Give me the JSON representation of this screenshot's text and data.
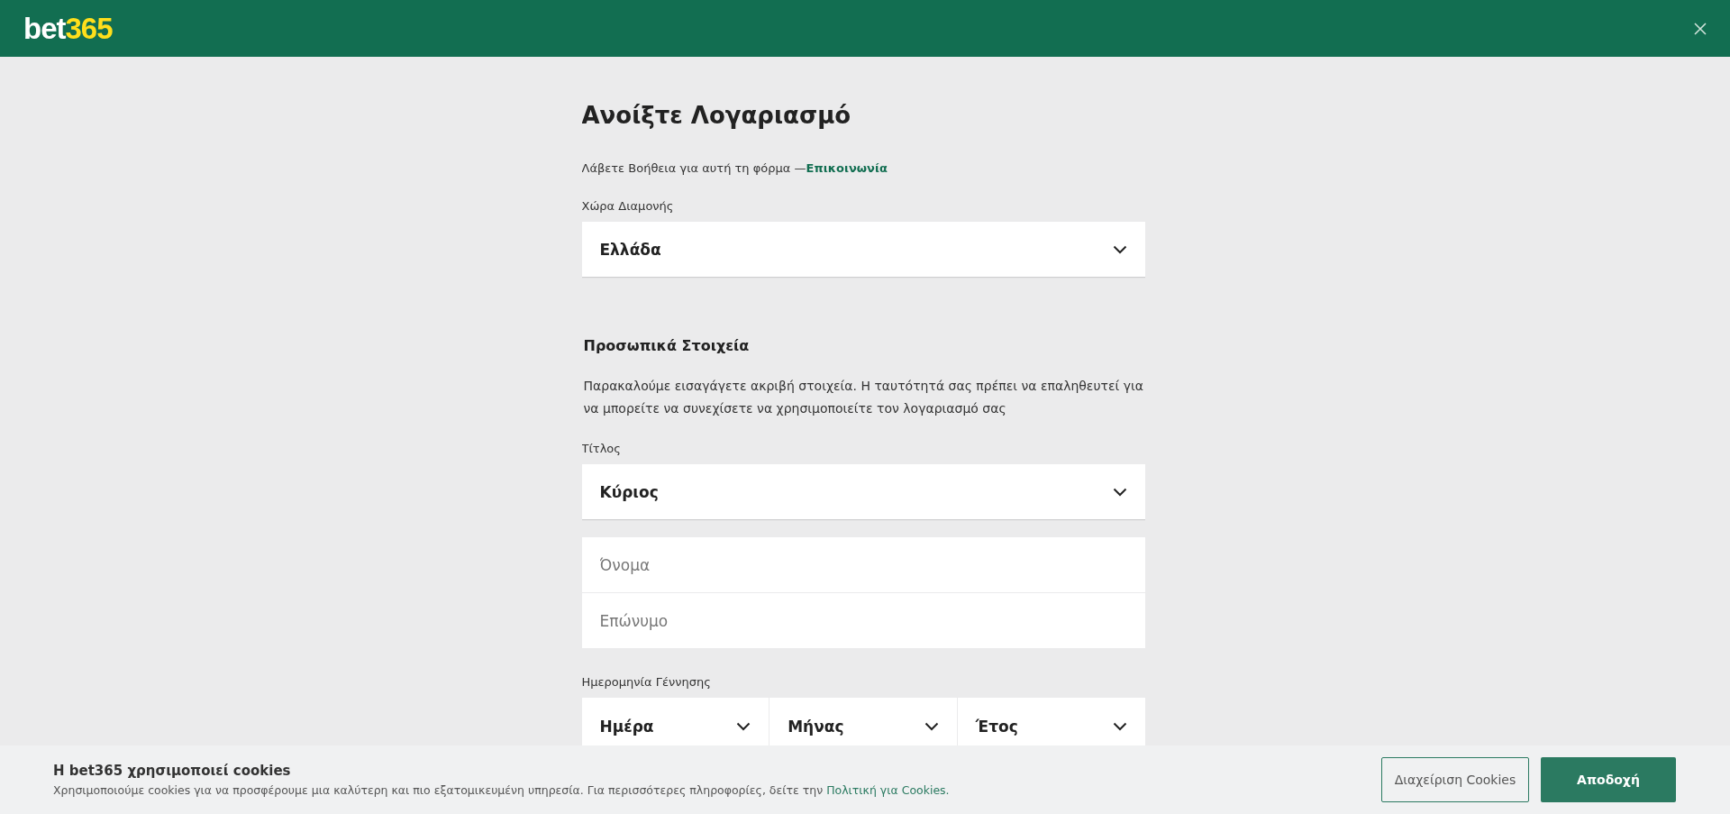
{
  "header": {
    "logo_first": "bet",
    "logo_second": "365"
  },
  "form": {
    "title": "Ανοίξτε Λογαριασμό",
    "help_text": "Λάβετε Βοήθεια για αυτή τη φόρμα —",
    "help_link": "Επικοινωνία",
    "country": {
      "label": "Χώρα Διαμονής",
      "value": "Ελλάδα"
    },
    "section_title": "Προσωπικά Στοιχεία",
    "section_text": "Παρακαλούμε εισαγάγετε ακριβή στοιχεία. Η ταυτότητά σας πρέπει να επαληθευτεί για να μπορείτε να συνεχίσετε να χρησιμοποιείτε τον λογαριασμό σας",
    "title_field": {
      "label": "Τίτλος",
      "value": "Κύριος"
    },
    "name_fields": [
      {
        "placeholder": "Όνομα"
      },
      {
        "placeholder": "Επώνυμο"
      }
    ],
    "dob": {
      "label": "Ημερομηνία Γέννησης",
      "selects": [
        {
          "value": "Ημέρα"
        },
        {
          "value": "Μήνας"
        },
        {
          "value": "Έτος"
        }
      ]
    }
  },
  "cookie_bar": {
    "title": "Η bet365 χρησιμοποιεί cookies",
    "text": "Χρησιμοποιούμε cookies για να προσφέρουμε μια καλύτερη και πιο εξατομικευμένη υπηρεσία. Για περισσότερες πληροφορίες, δείτε την",
    "link": "Πολιτική για Cookies.",
    "buttons": [
      {
        "label": "Διαχείριση Cookies",
        "kind": "secondary"
      },
      {
        "label": "Αποδοχή",
        "kind": "primary"
      }
    ]
  }
}
